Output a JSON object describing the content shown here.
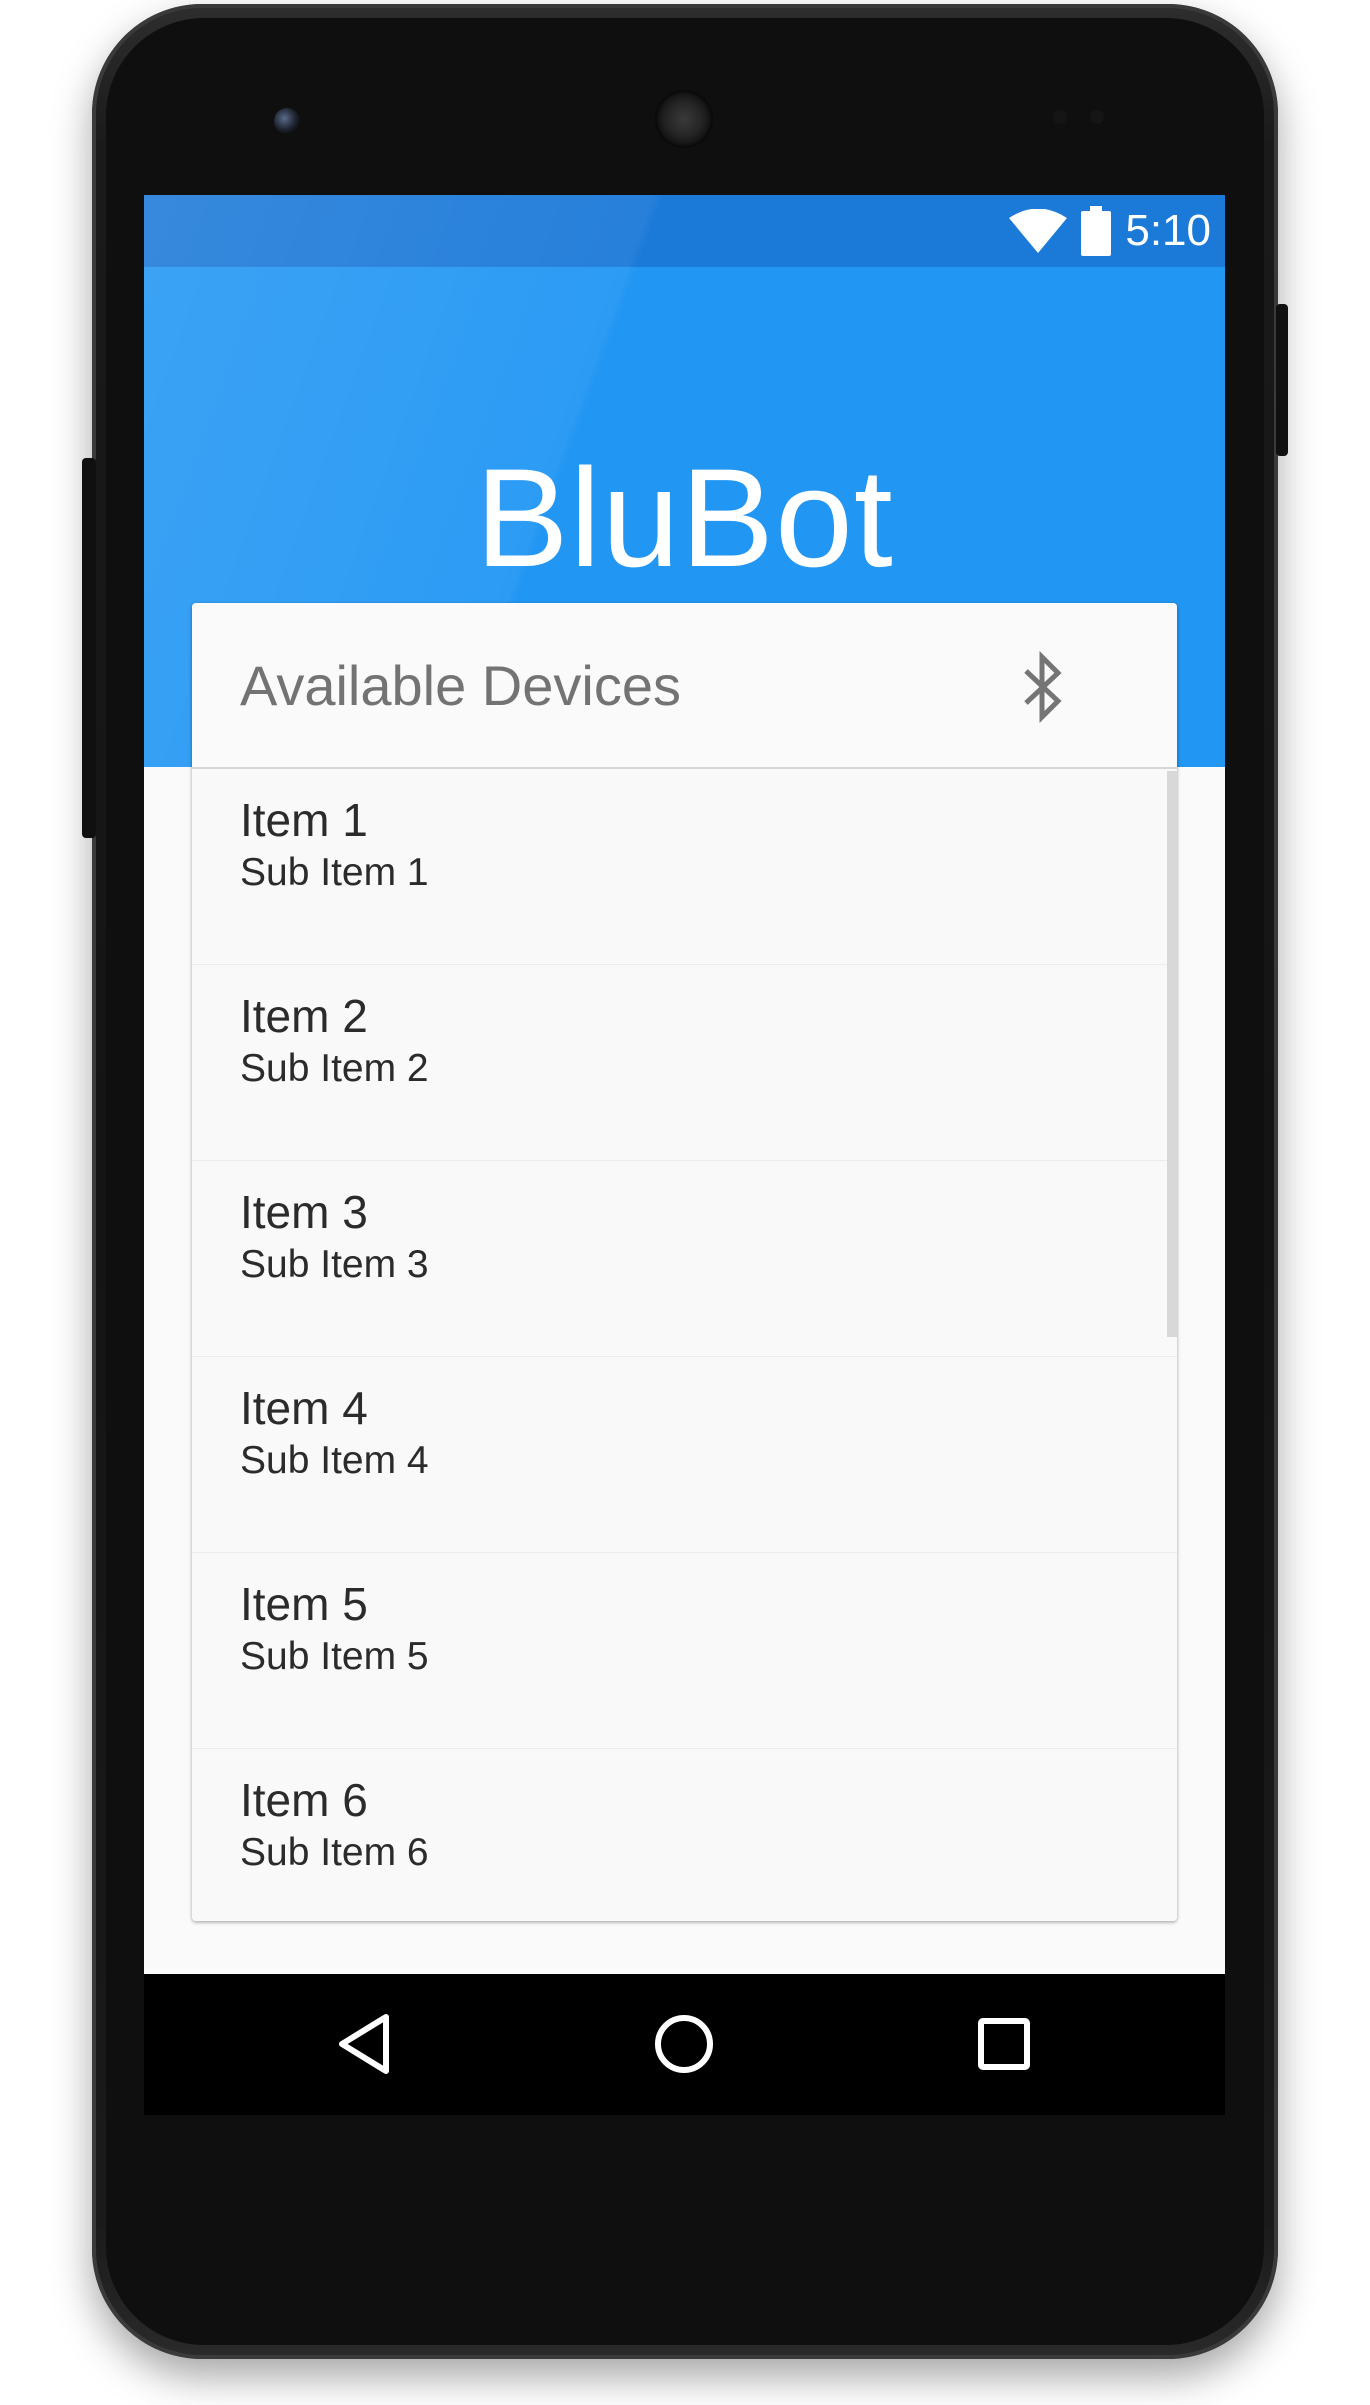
{
  "status_bar": {
    "time": "5:10"
  },
  "app": {
    "title": "BluBot"
  },
  "devices_card": {
    "header": "Available Devices",
    "items": [
      {
        "title": "Item 1",
        "subtitle": "Sub Item 1"
      },
      {
        "title": "Item 2",
        "subtitle": "Sub Item 2"
      },
      {
        "title": "Item 3",
        "subtitle": "Sub Item 3"
      },
      {
        "title": "Item 4",
        "subtitle": "Sub Item 4"
      },
      {
        "title": "Item 5",
        "subtitle": "Sub Item 5"
      },
      {
        "title": "Item 6",
        "subtitle": "Sub Item 6"
      }
    ]
  },
  "icons": {
    "status": [
      "wifi-icon",
      "battery-icon"
    ],
    "header": "bluetooth-icon",
    "navigation": [
      "back-icon",
      "home-icon",
      "recents-icon"
    ]
  },
  "colors": {
    "primary": "#2196f3",
    "status_bar": "#1b79d8",
    "card_background": "#f9f9f9",
    "header_text": "#737373"
  }
}
